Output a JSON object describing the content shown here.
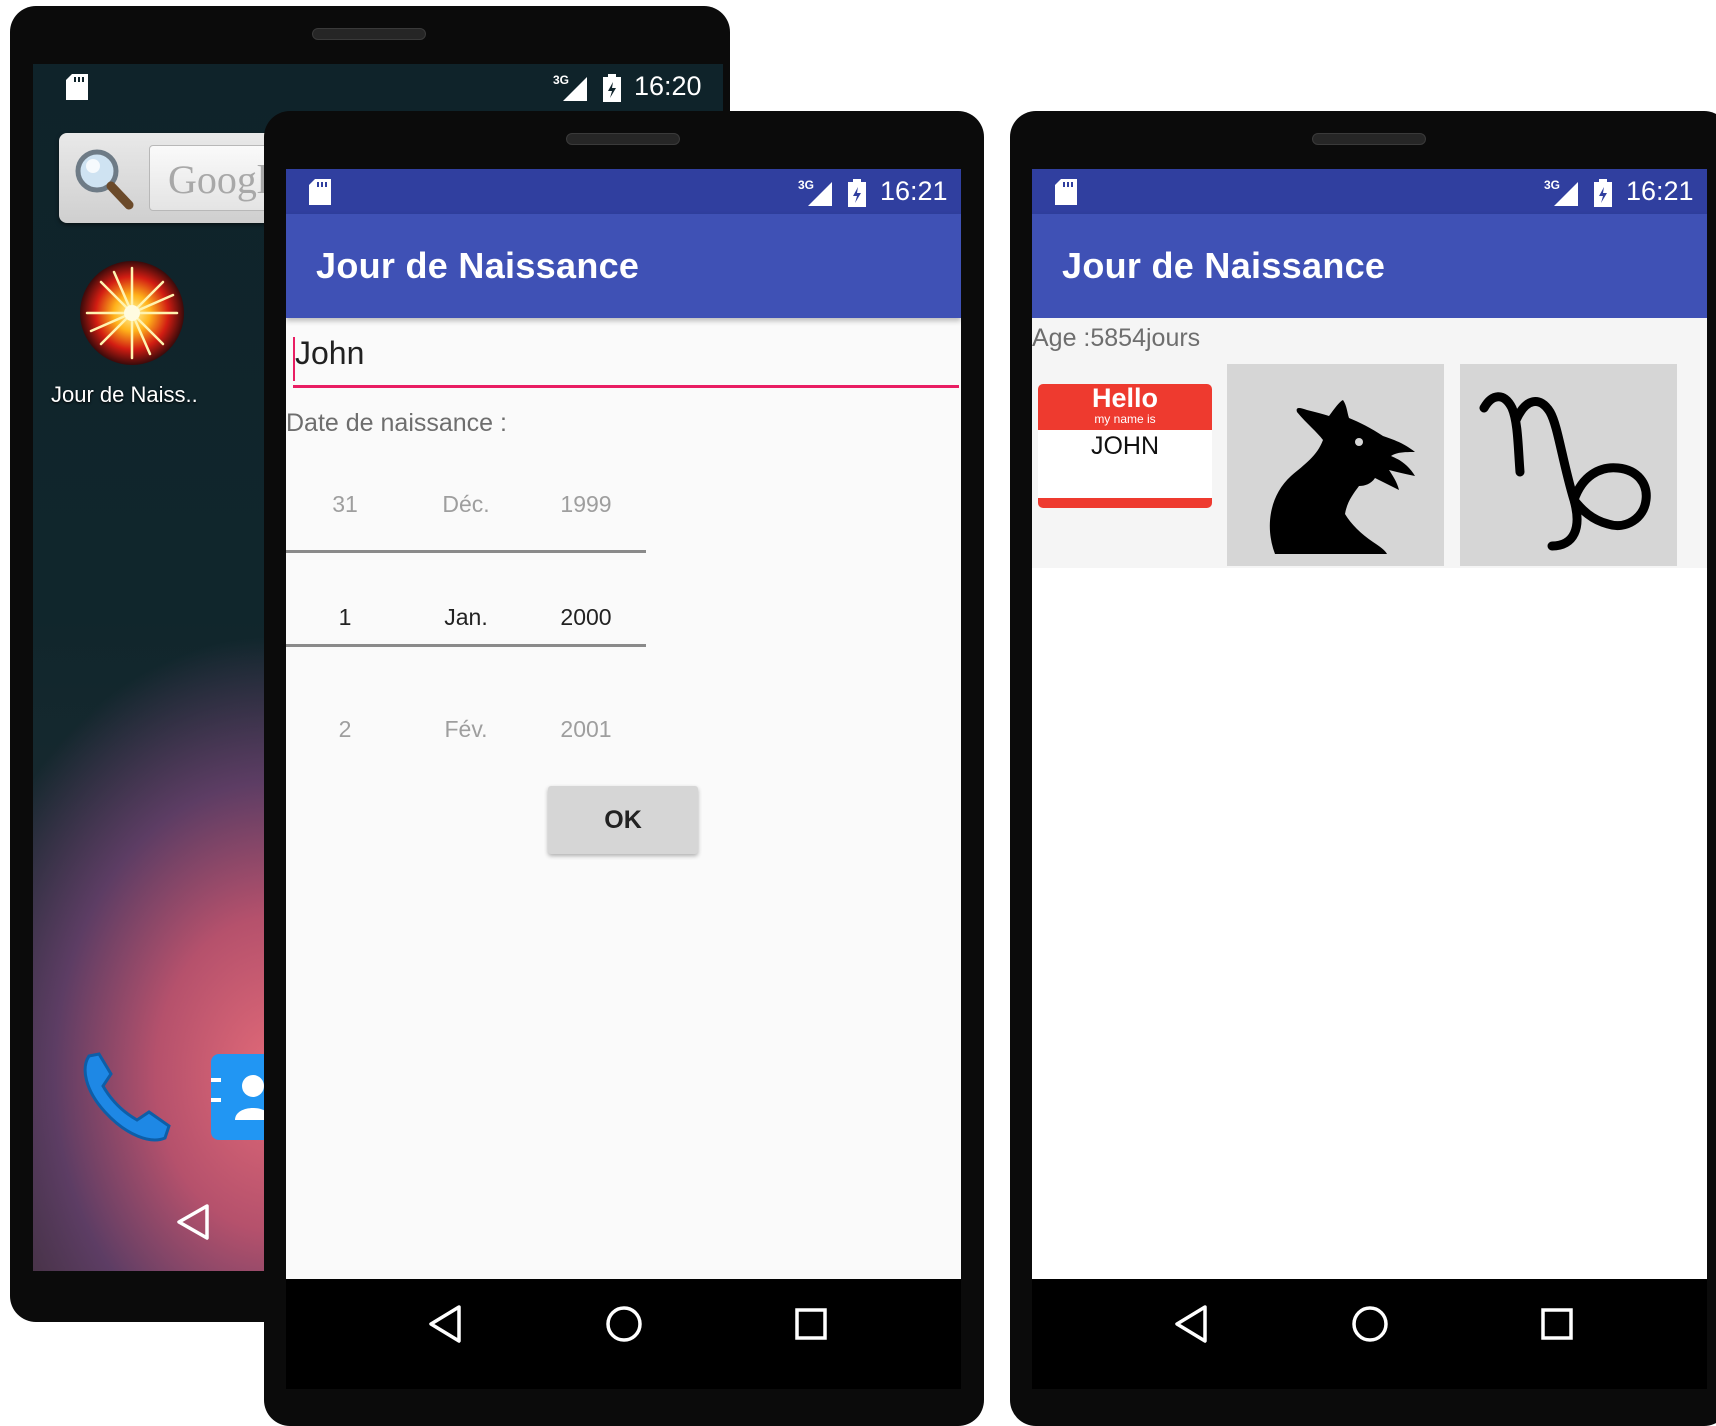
{
  "launcher": {
    "time": "16:20",
    "network": "3G",
    "search_placeholder": "Google",
    "app_label": "Jour de Naiss.."
  },
  "input_screen": {
    "time": "16:21",
    "network": "3G",
    "title": "Jour de Naissance",
    "name_value": "John",
    "date_label": "Date de naissance :",
    "picker": {
      "prev": {
        "day": "31",
        "month": "Déc.",
        "year": "1999"
      },
      "selected": {
        "day": "1",
        "month": "Jan.",
        "year": "2000"
      },
      "next": {
        "day": "2",
        "month": "Fév.",
        "year": "2001"
      }
    },
    "ok_label": "OK",
    "accent_color": "#e91e63"
  },
  "result_screen": {
    "time": "16:21",
    "network": "3G",
    "title": "Jour de Naissance",
    "age_text": "Age :5854jours",
    "name_tag": {
      "hello": "Hello",
      "subtitle": "my name is",
      "name": "JOHN"
    },
    "chinese_sign_icon": "dragon-icon",
    "zodiac_symbol": "♑",
    "zodiac_icon": "capricorn-icon"
  },
  "colors": {
    "primary": "#3f51b5",
    "status_bar": "#303f9f",
    "name_tag_red": "#ee3a2f"
  }
}
